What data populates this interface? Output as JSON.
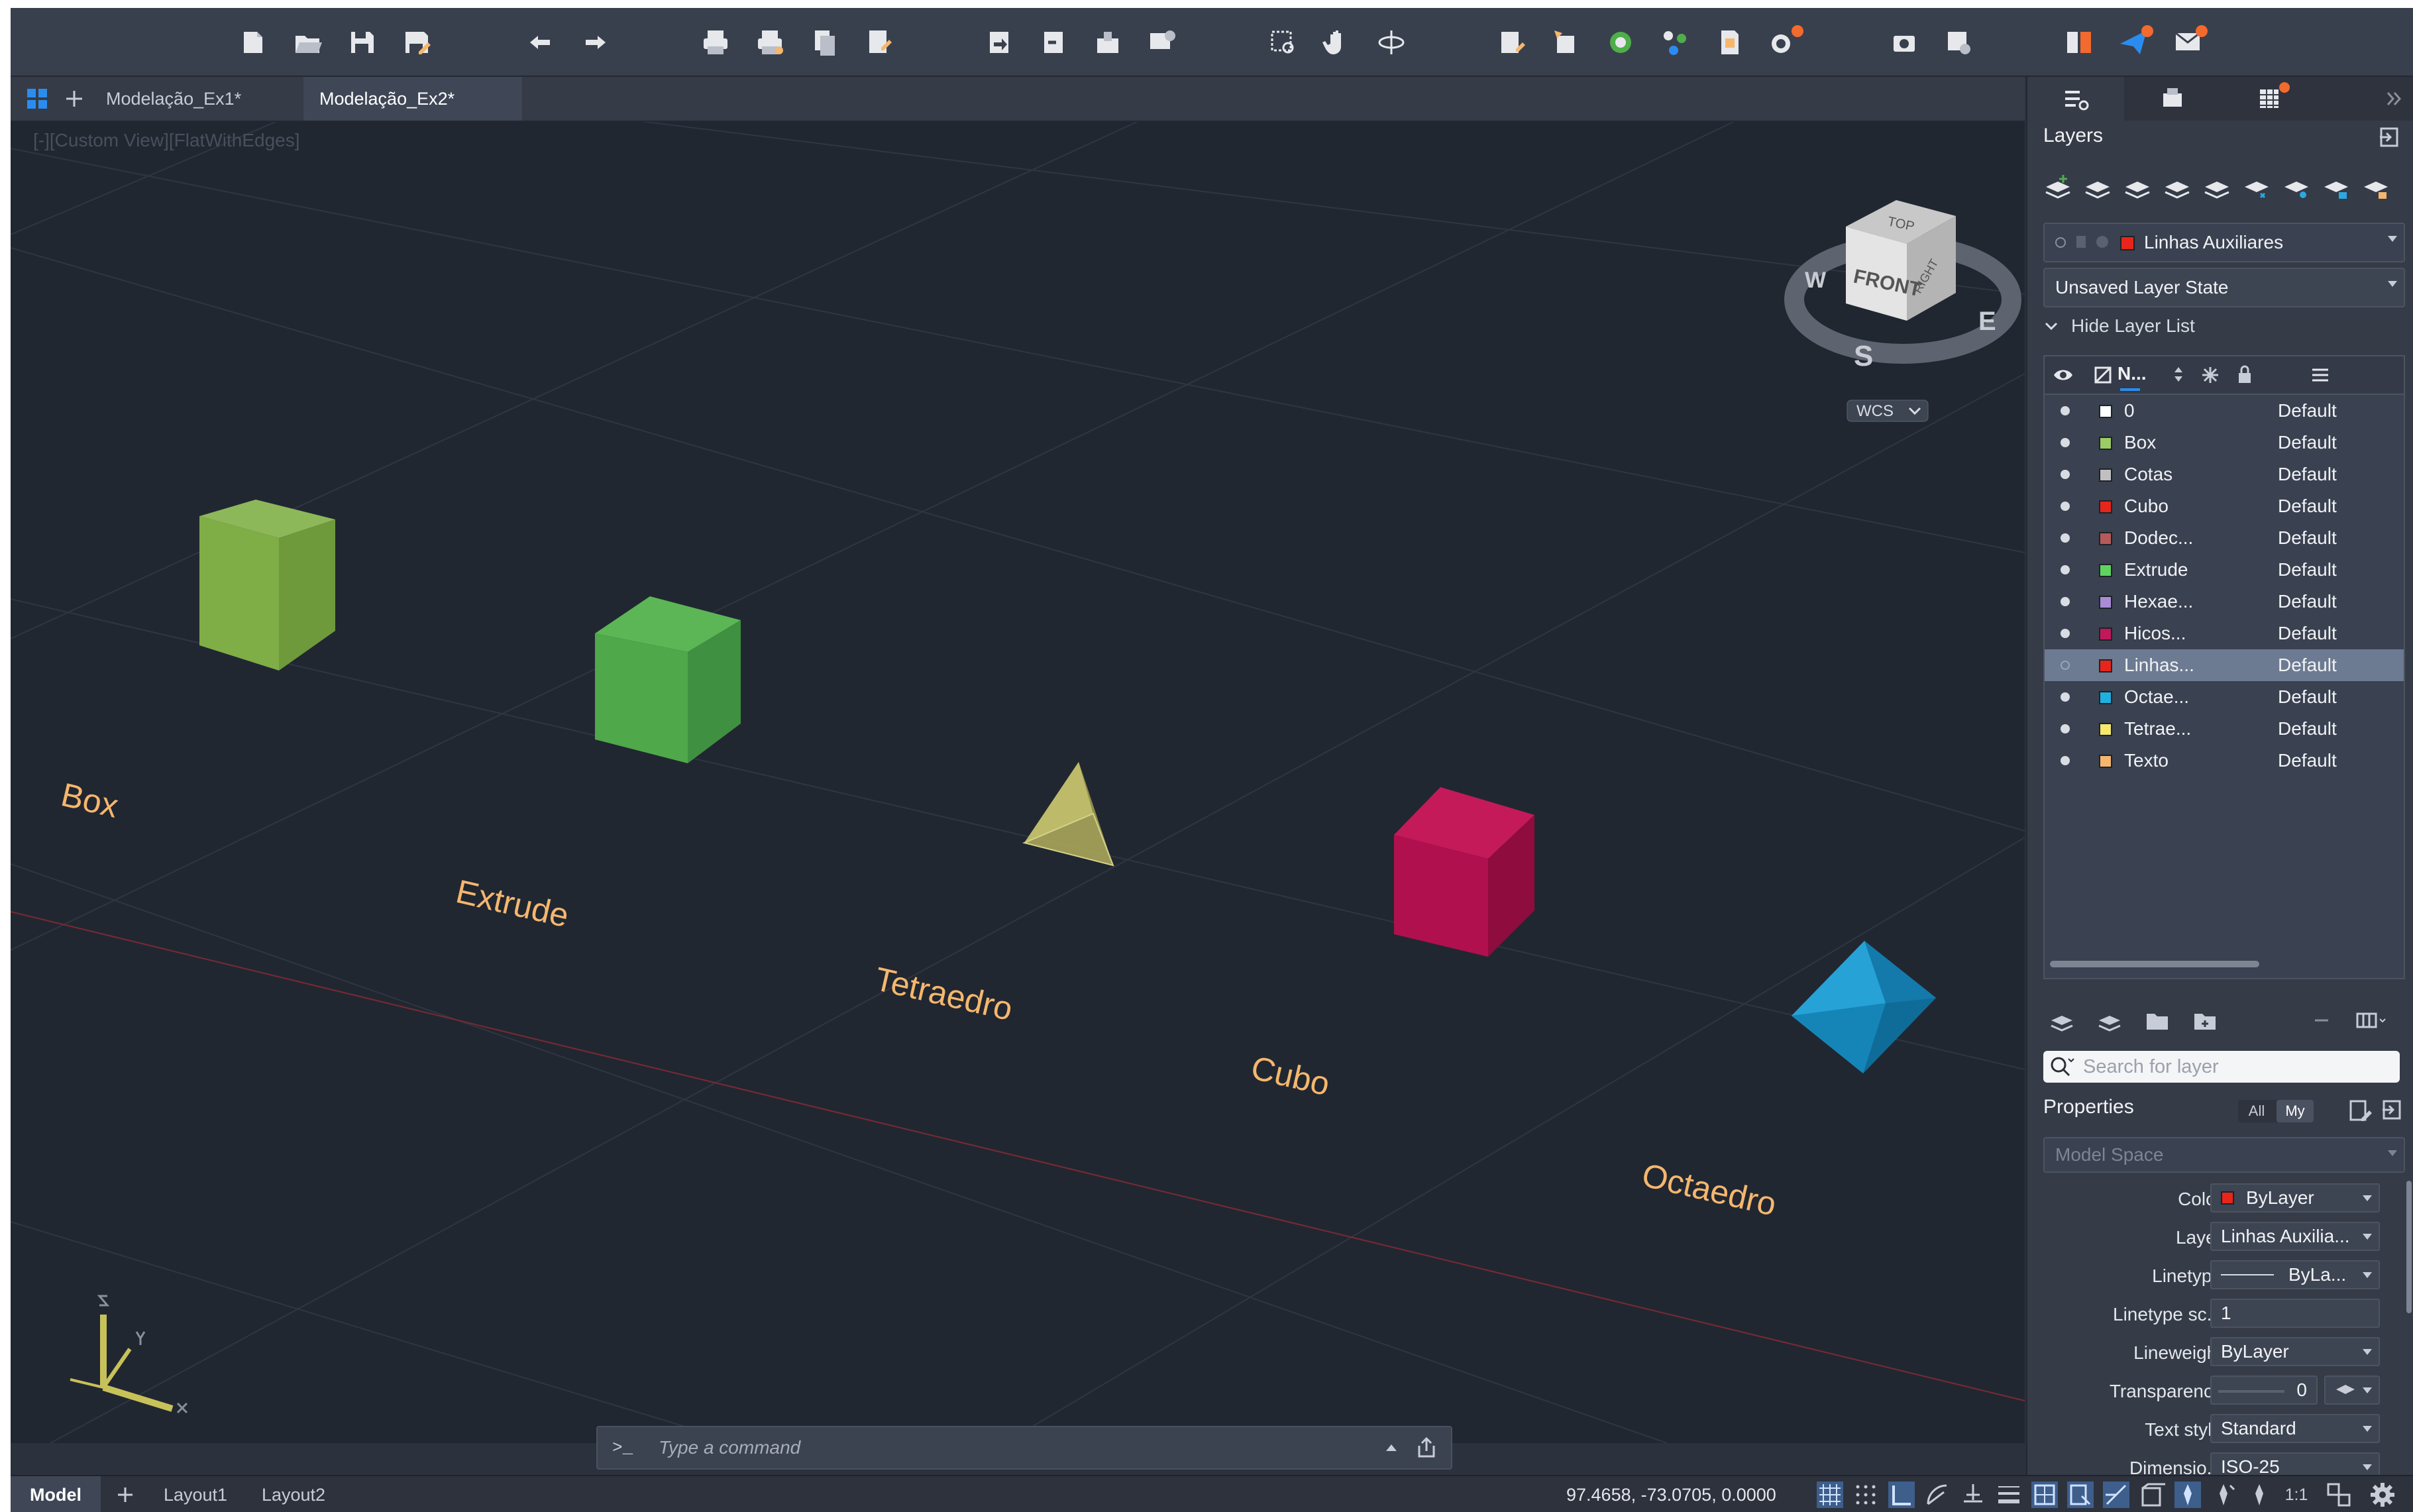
{
  "doc_tabs": [
    {
      "label": "Modelação_Ex1*"
    },
    {
      "label": "Modelação_Ex2*",
      "active": true
    }
  ],
  "viewport": {
    "view_label": "[-][Custom View][FlatWithEdges]",
    "objects": [
      "Box",
      "Extrude",
      "Tetraedro",
      "Cubo",
      "Octaedro"
    ],
    "viewcube": {
      "top": "TOP",
      "front": "FRONT",
      "right": "RIGHT",
      "compass": [
        "W",
        "S",
        "E"
      ],
      "wcs": "WCS"
    }
  },
  "command_line": {
    "prompt": ">_",
    "placeholder": "Type a command"
  },
  "status_bar": {
    "tabs": [
      "Model",
      "Layout1",
      "Layout2"
    ],
    "coordinates": "97.4658,  -73.0705, 0.0000",
    "scale": "1:1"
  },
  "layers_panel": {
    "title": "Layers",
    "current_layer": "Linhas Auxiliares",
    "layer_state": "Unsaved Layer State",
    "toggle_label": "Hide Layer List",
    "name_column": "N...",
    "layers": [
      {
        "name": "0",
        "style": "Default",
        "color": "#ffffff"
      },
      {
        "name": "Box",
        "style": "Default",
        "color": "#9ccc65"
      },
      {
        "name": "Cotas",
        "style": "Default",
        "color": "#c0c0c0"
      },
      {
        "name": "Cubo",
        "style": "Default",
        "color": "#e8251b"
      },
      {
        "name": "Dodec...",
        "style": "Default",
        "color": "#b55a5a"
      },
      {
        "name": "Extrude",
        "style": "Default",
        "color": "#5fd35f"
      },
      {
        "name": "Hexae...",
        "style": "Default",
        "color": "#a98bd6"
      },
      {
        "name": "Hicos...",
        "style": "Default",
        "color": "#c2185b"
      },
      {
        "name": "Linhas...",
        "style": "Default",
        "color": "#e8251b",
        "selected": true
      },
      {
        "name": "Octae...",
        "style": "Default",
        "color": "#1fb0e0"
      },
      {
        "name": "Tetrae...",
        "style": "Default",
        "color": "#f4e96b"
      },
      {
        "name": "Texto",
        "style": "Default",
        "color": "#f5b76e"
      }
    ],
    "search_placeholder": "Search for layer"
  },
  "properties_panel": {
    "title": "Properties",
    "filter_all": "All",
    "filter_my": "My",
    "space": "Model Space",
    "rows": [
      {
        "label": "Color",
        "value": "ByLayer"
      },
      {
        "label": "Layer",
        "value": "Linhas Auxilia..."
      },
      {
        "label": "Linetype",
        "value": "ByLa..."
      },
      {
        "label": "Linetype sc...",
        "value": "1"
      },
      {
        "label": "Lineweight",
        "value": "ByLayer"
      },
      {
        "label": "Transparency",
        "value": "0"
      },
      {
        "label": "Text style",
        "value": "Standard"
      },
      {
        "label": "Dimensio...",
        "value": "ISO-25"
      }
    ]
  },
  "colors": {
    "accent": "#2b8cf0",
    "text_labels": "#f5b76e",
    "box": "#7fae46",
    "extrude": "#4fa84a",
    "tetraedro": "#a8a65a",
    "cubo": "#b0104d",
    "octaedro": "#1a8fc4"
  }
}
